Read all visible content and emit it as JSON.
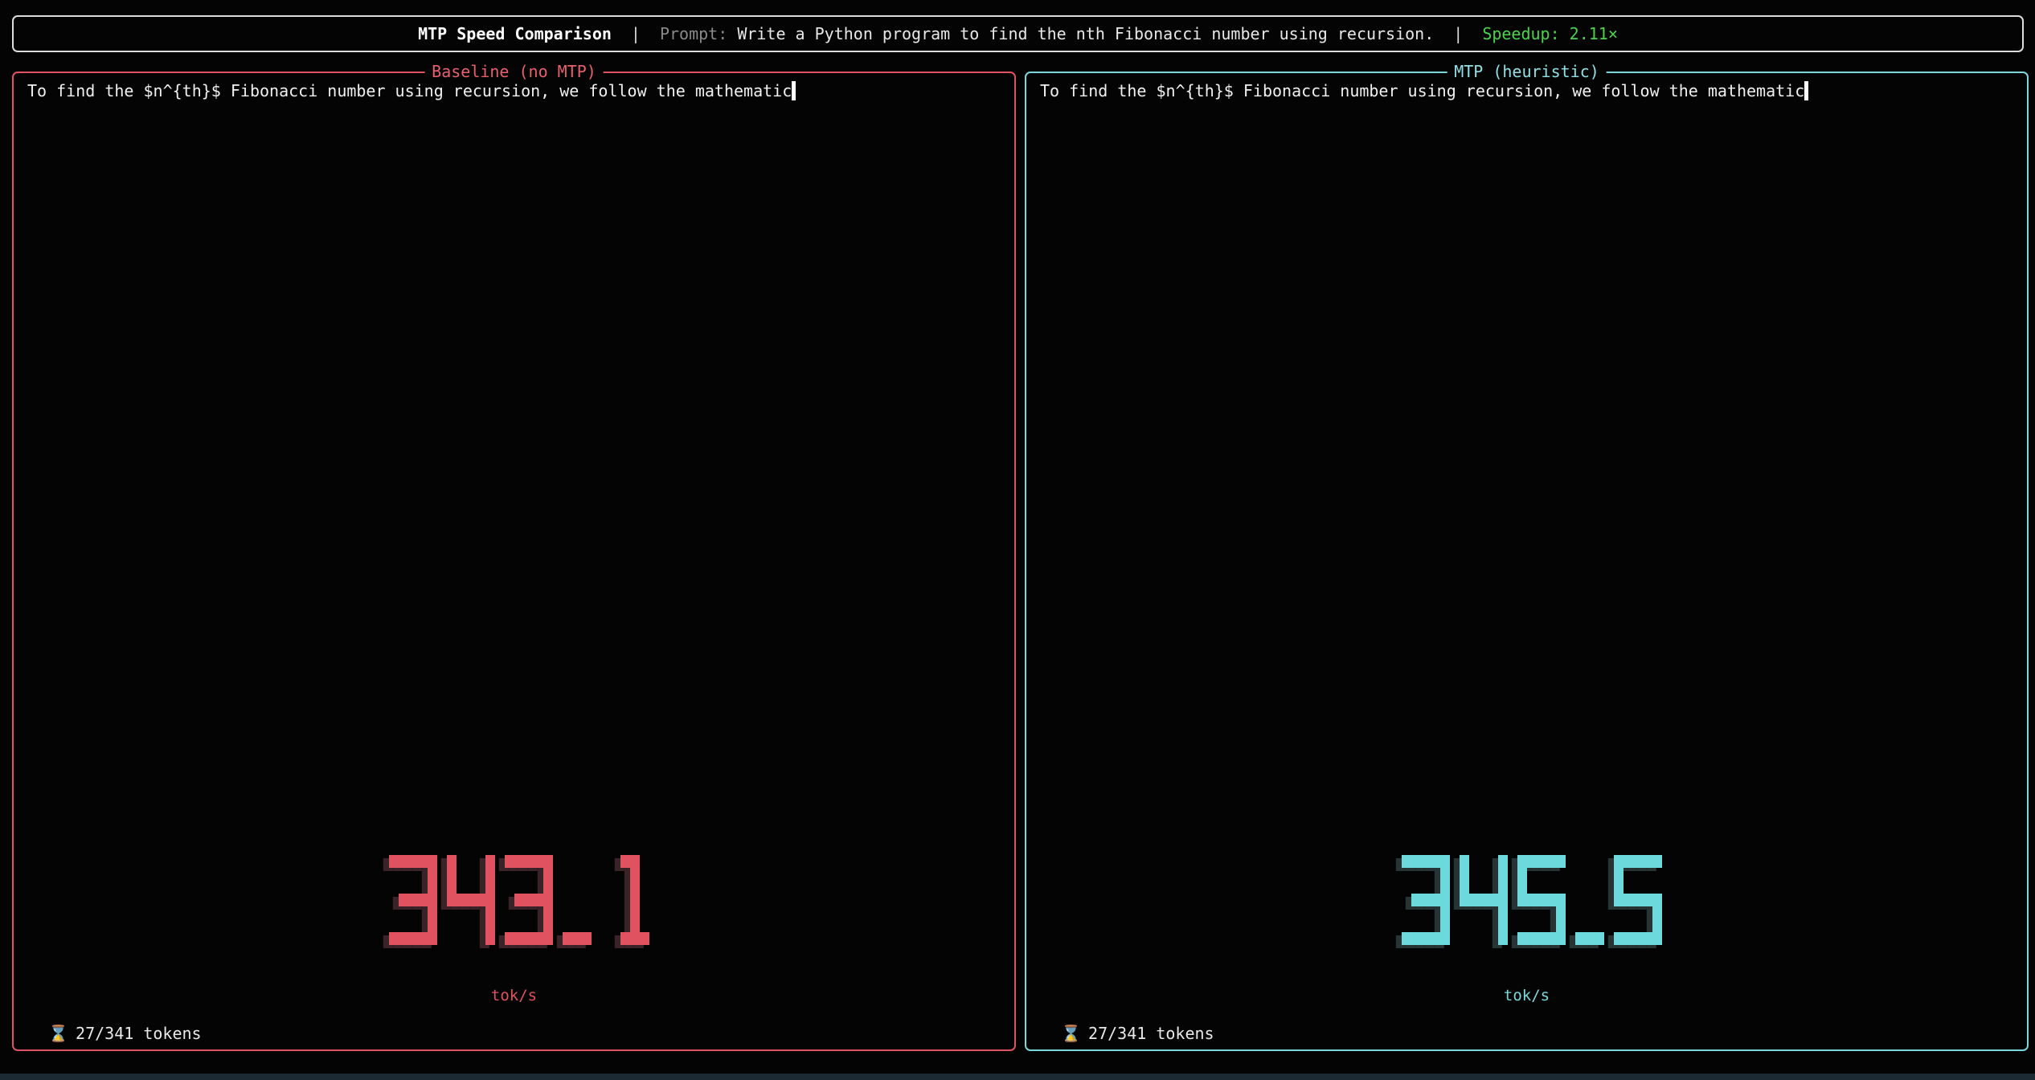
{
  "header": {
    "title": "MTP Speed Comparison",
    "separator": "|",
    "prompt_label": "Prompt:",
    "prompt_text": "Write a Python program to find the nth Fibonacci number using recursion.",
    "speedup": "Speedup: 2.11×"
  },
  "panels": {
    "baseline": {
      "title": "Baseline (no MTP)",
      "stream_text": "To find the $n^{th}$ Fibonacci number using recursion, we follow the mathematic",
      "rate": "343.1",
      "unit": "tok/s",
      "progress": "27/341 tokens",
      "color": "#e05260",
      "shadow": "#3a2226"
    },
    "mtp": {
      "title": "MTP (heuristic)",
      "stream_text": "To find the $n^{th}$ Fibonacci number using recursion, we follow the mathematic",
      "rate": "345.5",
      "unit": "tok/s",
      "progress": "27/341 tokens",
      "color": "#6cd9dc",
      "shadow": "#263436"
    }
  },
  "icons": {
    "progress": "hourglass-icon"
  }
}
